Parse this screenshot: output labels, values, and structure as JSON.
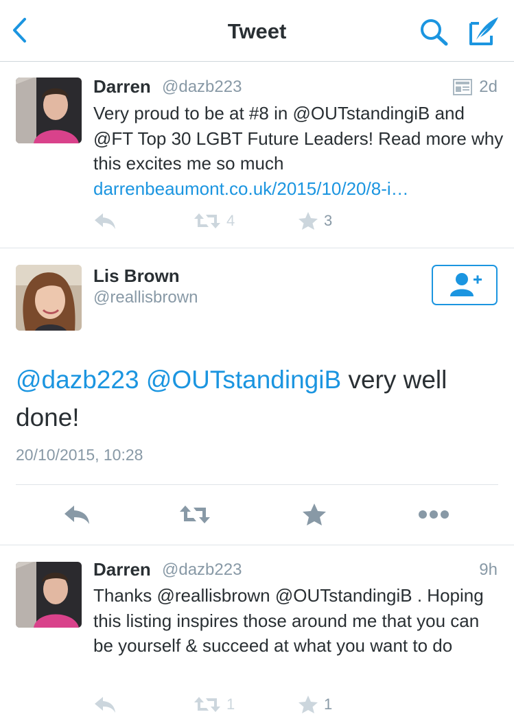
{
  "header": {
    "title": "Tweet"
  },
  "tweets": [
    {
      "name": "Darren",
      "handle": "@dazb223",
      "time": "2d",
      "text_plain": "Very proud to be at #8 in @OUTstandingiB and @FT Top 30 LGBT Future Leaders! Read more why this excites me so much",
      "link": "darrenbeaumont.co.uk/2015/10/20/8-i…",
      "retweets": "4",
      "likes": "3"
    },
    {
      "name": "Darren",
      "handle": "@dazb223",
      "time": "9h",
      "text_plain": "Thanks @reallisbrown @OUTstandingiB . Hoping this listing inspires those around me that you can be yourself & succeed at what you want to do",
      "retweets": "1",
      "likes": "1"
    }
  ],
  "focus": {
    "name": "Lis Brown",
    "handle": "@reallisbrown",
    "mention_1": "@dazb223",
    "mention_2": "@OUTstandingiB",
    "text_rest": " very well done!",
    "timestamp": "20/10/2015, 10:28"
  },
  "colors": {
    "accent": "#1b95e0",
    "muted": "#8899a6",
    "action_icon": "#8899a6",
    "faint_icon": "#aab8c2"
  }
}
